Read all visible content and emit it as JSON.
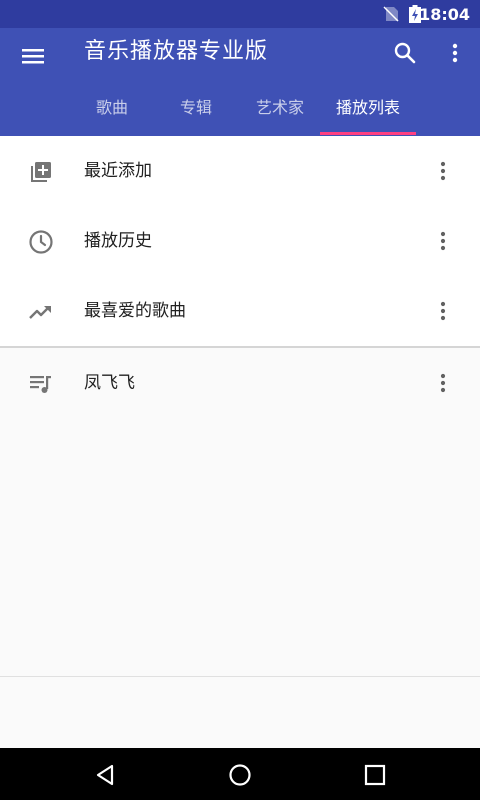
{
  "status_bar": {
    "time": "18:04",
    "icons": [
      "no-sim-icon",
      "battery-charging-icon"
    ],
    "background": "#2f3c9f"
  },
  "app_bar": {
    "title": "音乐播放器专业版",
    "background": "#3f51b5",
    "icons": [
      "menu-icon",
      "search-icon",
      "more-vert-icon"
    ]
  },
  "tabs": {
    "items": [
      {
        "label": "歌曲"
      },
      {
        "label": "专辑"
      },
      {
        "label": "艺术家"
      },
      {
        "label": "播放列表"
      }
    ],
    "active_index": 3,
    "indicator_color": "#ff4081"
  },
  "playlists": {
    "smart": [
      {
        "label": "最近添加",
        "icon": "playlist-add-icon"
      },
      {
        "label": "播放历史",
        "icon": "history-clock-icon"
      },
      {
        "label": "最喜爱的歌曲",
        "icon": "trending-up-icon"
      }
    ],
    "user": [
      {
        "label": "凤飞飞",
        "icon": "queue-music-icon"
      }
    ]
  },
  "nav_bar": {
    "buttons": [
      "back-triangle-icon",
      "home-circle-icon",
      "recents-square-icon"
    ]
  }
}
